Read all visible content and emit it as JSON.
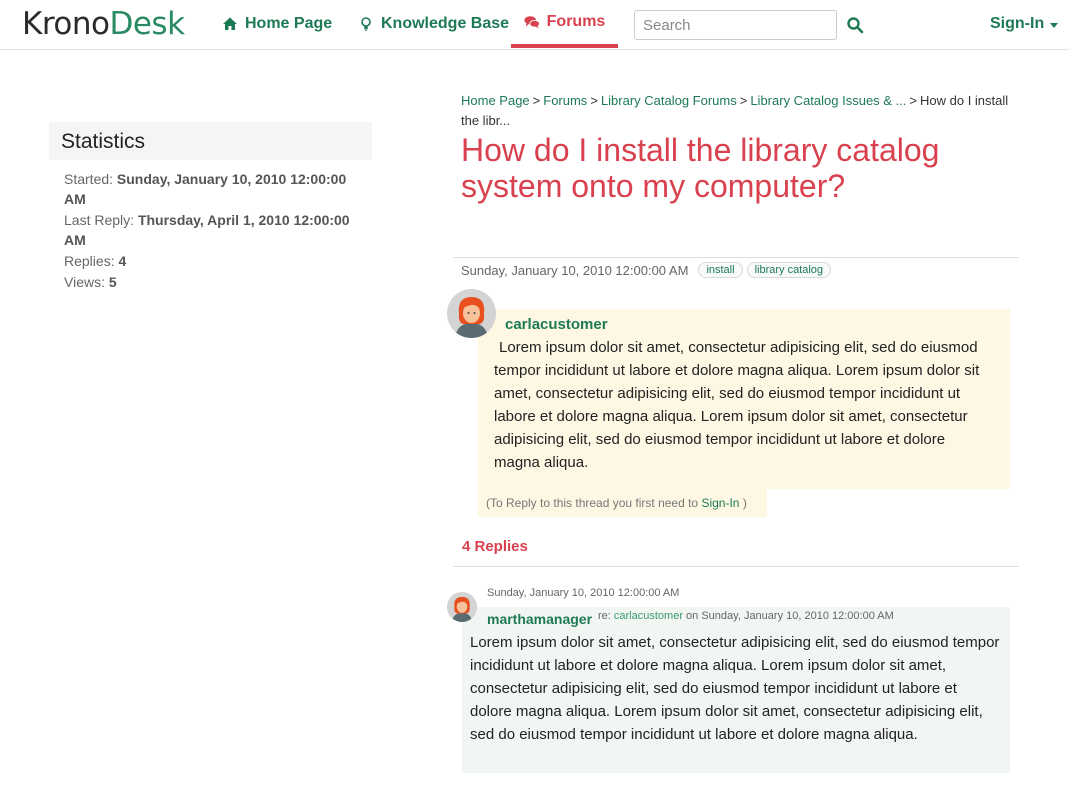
{
  "brand": {
    "logo_part1": "Krono",
    "logo_part2": "Desk"
  },
  "nav": {
    "home": "Home Page",
    "knowledge_base": "Knowledge Base",
    "forums": "Forums",
    "search_placeholder": "Search",
    "sign_in": "Sign-In"
  },
  "colors": {
    "brand_green": "#1e7a55",
    "accent_red": "#d9414f",
    "post_bg": "#fdf7e3",
    "reply_bg": "#f2f6f3"
  },
  "sidebar": {
    "title": "Statistics",
    "started_label": "Started:",
    "started_value": "Sunday, January 10, 2010 12:00:00 AM",
    "last_reply_label": "Last Reply:",
    "last_reply_value": "Thursday, April 1, 2010 12:00:00 AM",
    "replies_label": "Replies:",
    "replies_value": "4",
    "views_label": "Views:",
    "views_value": "5"
  },
  "breadcrumb": {
    "items": [
      "Home Page",
      "Forums",
      "Library Catalog Forums",
      "Library Catalog Issues & ..."
    ],
    "current": "How do I install the libr...",
    "separator": ">"
  },
  "thread": {
    "title": "How do I install the library catalog system onto my computer?",
    "date": "Sunday, January 10, 2010 12:00:00 AM",
    "tags": [
      "install",
      "library catalog"
    ],
    "author": "carlacustomer",
    "body": "Lorem ipsum dolor sit amet, consectetur adipisicing elit, sed do eiusmod tempor incididunt ut labore et dolore magna aliqua. Lorem ipsum dolor sit amet, consectetur adipisicing elit, sed do eiusmod tempor incididunt ut labore et dolore magna aliqua. Lorem ipsum dolor sit amet, consectetur adipisicing elit, sed do eiusmod tempor incididunt ut labore et dolore magna aliqua.",
    "reply_note_prefix": "(To Reply to this thread you first need to",
    "reply_note_link": "Sign-In",
    "reply_note_suffix": ")"
  },
  "replies": {
    "count_label": "4 Replies",
    "items": [
      {
        "date": "Sunday, January 10, 2010 12:00:00 AM",
        "author": "marthamanager",
        "re_prefix": "re:",
        "re_user": "carlacustomer",
        "re_suffix": "on Sunday, January 10, 2010 12:00:00 AM",
        "body": "Lorem ipsum dolor sit amet, consectetur adipisicing elit, sed do eiusmod tempor incididunt ut labore et dolore magna aliqua. Lorem ipsum dolor sit amet, consectetur adipisicing elit, sed do eiusmod tempor incididunt ut labore et dolore magna aliqua. Lorem ipsum dolor sit amet, consectetur adipisicing elit, sed do eiusmod tempor incididunt ut labore et dolore magna aliqua."
      }
    ]
  }
}
